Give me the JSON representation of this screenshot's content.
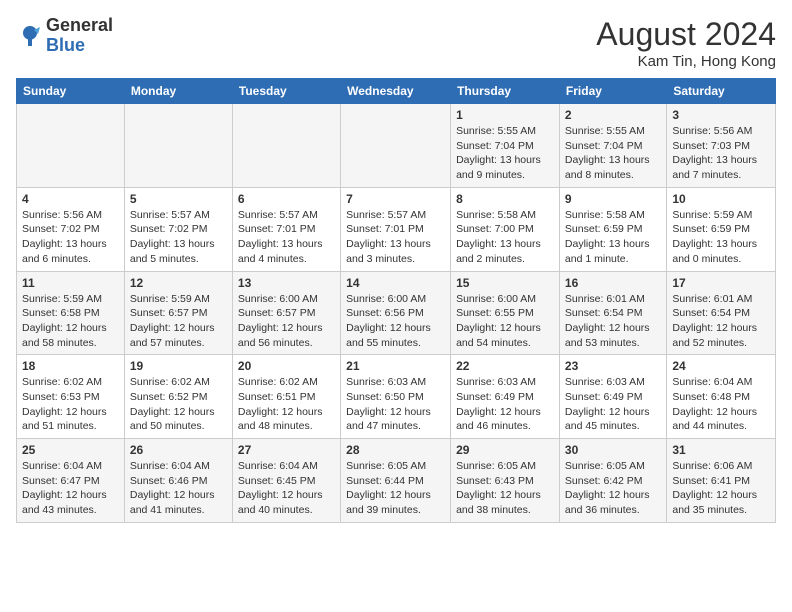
{
  "logo": {
    "general": "General",
    "blue": "Blue"
  },
  "title": {
    "month_year": "August 2024",
    "location": "Kam Tin, Hong Kong"
  },
  "days_of_week": [
    "Sunday",
    "Monday",
    "Tuesday",
    "Wednesday",
    "Thursday",
    "Friday",
    "Saturday"
  ],
  "weeks": [
    [
      {
        "day": "",
        "content": ""
      },
      {
        "day": "",
        "content": ""
      },
      {
        "day": "",
        "content": ""
      },
      {
        "day": "",
        "content": ""
      },
      {
        "day": "1",
        "content": "Sunrise: 5:55 AM\nSunset: 7:04 PM\nDaylight: 13 hours and 9 minutes."
      },
      {
        "day": "2",
        "content": "Sunrise: 5:55 AM\nSunset: 7:04 PM\nDaylight: 13 hours and 8 minutes."
      },
      {
        "day": "3",
        "content": "Sunrise: 5:56 AM\nSunset: 7:03 PM\nDaylight: 13 hours and 7 minutes."
      }
    ],
    [
      {
        "day": "4",
        "content": "Sunrise: 5:56 AM\nSunset: 7:02 PM\nDaylight: 13 hours and 6 minutes."
      },
      {
        "day": "5",
        "content": "Sunrise: 5:57 AM\nSunset: 7:02 PM\nDaylight: 13 hours and 5 minutes."
      },
      {
        "day": "6",
        "content": "Sunrise: 5:57 AM\nSunset: 7:01 PM\nDaylight: 13 hours and 4 minutes."
      },
      {
        "day": "7",
        "content": "Sunrise: 5:57 AM\nSunset: 7:01 PM\nDaylight: 13 hours and 3 minutes."
      },
      {
        "day": "8",
        "content": "Sunrise: 5:58 AM\nSunset: 7:00 PM\nDaylight: 13 hours and 2 minutes."
      },
      {
        "day": "9",
        "content": "Sunrise: 5:58 AM\nSunset: 6:59 PM\nDaylight: 13 hours and 1 minute."
      },
      {
        "day": "10",
        "content": "Sunrise: 5:59 AM\nSunset: 6:59 PM\nDaylight: 13 hours and 0 minutes."
      }
    ],
    [
      {
        "day": "11",
        "content": "Sunrise: 5:59 AM\nSunset: 6:58 PM\nDaylight: 12 hours and 58 minutes."
      },
      {
        "day": "12",
        "content": "Sunrise: 5:59 AM\nSunset: 6:57 PM\nDaylight: 12 hours and 57 minutes."
      },
      {
        "day": "13",
        "content": "Sunrise: 6:00 AM\nSunset: 6:57 PM\nDaylight: 12 hours and 56 minutes."
      },
      {
        "day": "14",
        "content": "Sunrise: 6:00 AM\nSunset: 6:56 PM\nDaylight: 12 hours and 55 minutes."
      },
      {
        "day": "15",
        "content": "Sunrise: 6:00 AM\nSunset: 6:55 PM\nDaylight: 12 hours and 54 minutes."
      },
      {
        "day": "16",
        "content": "Sunrise: 6:01 AM\nSunset: 6:54 PM\nDaylight: 12 hours and 53 minutes."
      },
      {
        "day": "17",
        "content": "Sunrise: 6:01 AM\nSunset: 6:54 PM\nDaylight: 12 hours and 52 minutes."
      }
    ],
    [
      {
        "day": "18",
        "content": "Sunrise: 6:02 AM\nSunset: 6:53 PM\nDaylight: 12 hours and 51 minutes."
      },
      {
        "day": "19",
        "content": "Sunrise: 6:02 AM\nSunset: 6:52 PM\nDaylight: 12 hours and 50 minutes."
      },
      {
        "day": "20",
        "content": "Sunrise: 6:02 AM\nSunset: 6:51 PM\nDaylight: 12 hours and 48 minutes."
      },
      {
        "day": "21",
        "content": "Sunrise: 6:03 AM\nSunset: 6:50 PM\nDaylight: 12 hours and 47 minutes."
      },
      {
        "day": "22",
        "content": "Sunrise: 6:03 AM\nSunset: 6:49 PM\nDaylight: 12 hours and 46 minutes."
      },
      {
        "day": "23",
        "content": "Sunrise: 6:03 AM\nSunset: 6:49 PM\nDaylight: 12 hours and 45 minutes."
      },
      {
        "day": "24",
        "content": "Sunrise: 6:04 AM\nSunset: 6:48 PM\nDaylight: 12 hours and 44 minutes."
      }
    ],
    [
      {
        "day": "25",
        "content": "Sunrise: 6:04 AM\nSunset: 6:47 PM\nDaylight: 12 hours and 43 minutes."
      },
      {
        "day": "26",
        "content": "Sunrise: 6:04 AM\nSunset: 6:46 PM\nDaylight: 12 hours and 41 minutes."
      },
      {
        "day": "27",
        "content": "Sunrise: 6:04 AM\nSunset: 6:45 PM\nDaylight: 12 hours and 40 minutes."
      },
      {
        "day": "28",
        "content": "Sunrise: 6:05 AM\nSunset: 6:44 PM\nDaylight: 12 hours and 39 minutes."
      },
      {
        "day": "29",
        "content": "Sunrise: 6:05 AM\nSunset: 6:43 PM\nDaylight: 12 hours and 38 minutes."
      },
      {
        "day": "30",
        "content": "Sunrise: 6:05 AM\nSunset: 6:42 PM\nDaylight: 12 hours and 36 minutes."
      },
      {
        "day": "31",
        "content": "Sunrise: 6:06 AM\nSunset: 6:41 PM\nDaylight: 12 hours and 35 minutes."
      }
    ]
  ]
}
